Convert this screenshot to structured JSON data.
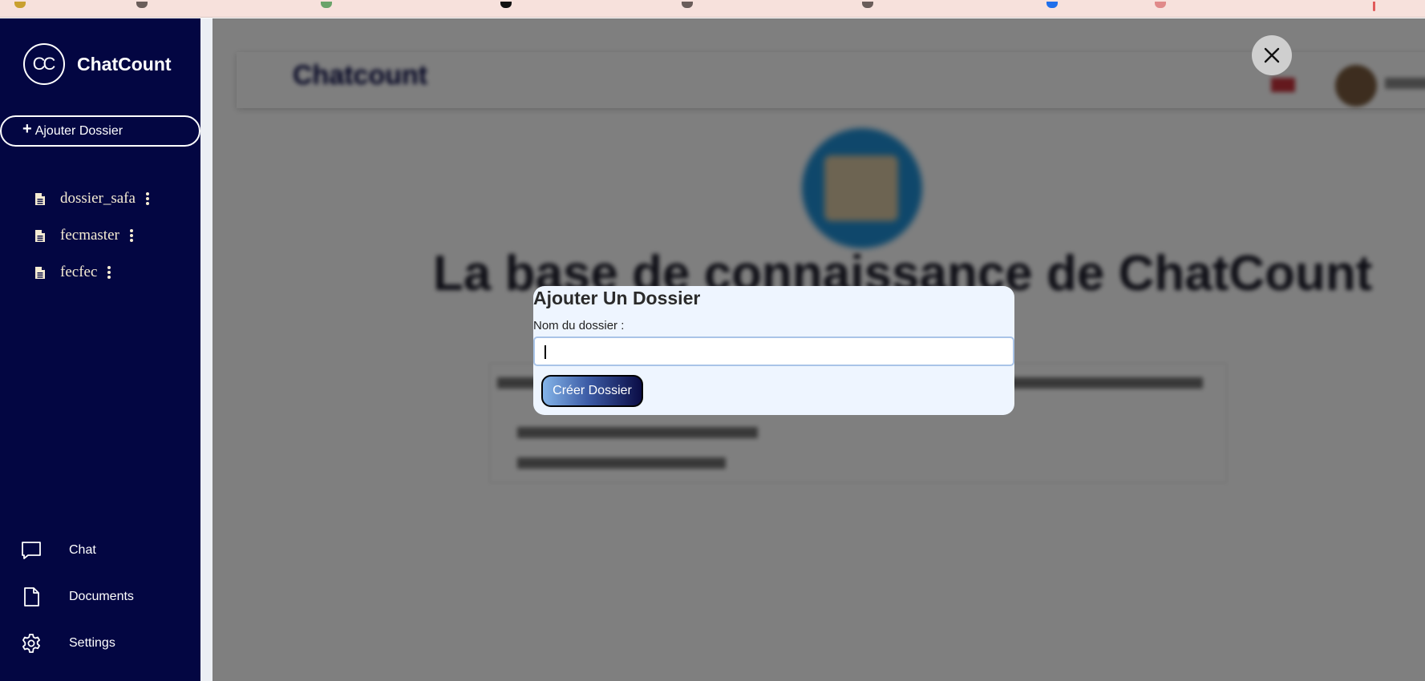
{
  "app": {
    "name": "ChatCount",
    "logo_text": "CC"
  },
  "sidebar": {
    "add_folder_label": "Ajouter Dossier",
    "folders": [
      {
        "name": "dossier_safa"
      },
      {
        "name": "fecmaster"
      },
      {
        "name": "fecfec"
      }
    ],
    "nav": [
      {
        "label": "Chat",
        "icon": "chat-bubble-icon"
      },
      {
        "label": "Documents",
        "icon": "document-icon"
      },
      {
        "label": "Settings",
        "icon": "gear-icon"
      }
    ]
  },
  "background": {
    "topbar_title": "Chatcount",
    "hero_title": "La base de connaissance de ChatCount"
  },
  "modal": {
    "title": "Ajouter Un Dossier",
    "field_label": "Nom du dossier :",
    "input_value": "",
    "submit_label": "Créer Dossier"
  },
  "colors": {
    "sidebar_bg": "#030642",
    "modal_bg": "#eef5ff",
    "folder_text": "#f6ecd3",
    "overlay": "rgba(0,0,0,0.5)"
  }
}
